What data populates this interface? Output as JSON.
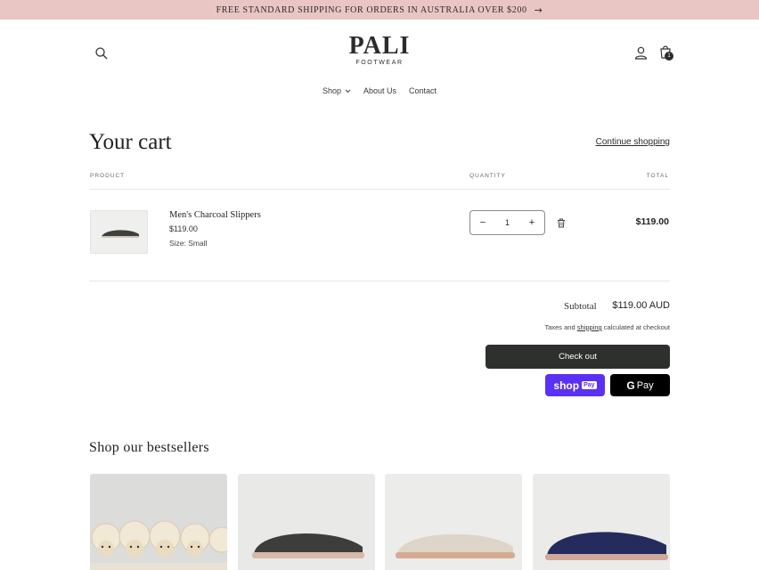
{
  "announcement": {
    "text": "FREE STANDARD SHIPPING FOR ORDERS IN AUSTRALIA OVER $200",
    "arrow": "→"
  },
  "header": {
    "logo_main": "PALI",
    "logo_sub": "FOOTWEAR",
    "cart_count": "1",
    "icons": [
      "search-icon",
      "account-icon",
      "cart-icon"
    ]
  },
  "nav": {
    "items": [
      {
        "label": "Shop"
      },
      {
        "label": "About Us"
      },
      {
        "label": "Contact"
      }
    ]
  },
  "cart": {
    "title": "Your cart",
    "continue_label": "Continue shopping",
    "columns": {
      "product": "PRODUCT",
      "quantity": "QUANTITY",
      "total": "TOTAL"
    },
    "items": [
      {
        "name": "Men's Charcoal Slippers",
        "price": "$119.00",
        "size": "Size: Small",
        "quantity": "1",
        "total": "$119.00"
      }
    ],
    "subtotal_label": "Subtotal",
    "subtotal_value": "$119.00 AUD",
    "taxes_prefix": "Taxes and",
    "taxes_link": "shipping",
    "taxes_suffix": "calculated at checkout",
    "checkout_label": "Check out",
    "shoppay_label": "shop",
    "shoppay_badge": "Pay",
    "gpay_label": "Pay",
    "gpay_g": "G"
  },
  "bestsellers": {
    "title": "Shop our bestsellers",
    "products": [
      {
        "name": "sheep-slippers"
      },
      {
        "name": "charcoal-slippers"
      },
      {
        "name": "natural-slippers"
      },
      {
        "name": "navy-slippers"
      }
    ]
  },
  "colors": {
    "announcement_bg": "#e9c6c4",
    "checkout_bg": "#2e302d",
    "shoppay": "#5a31f4",
    "gpay": "#000000"
  }
}
